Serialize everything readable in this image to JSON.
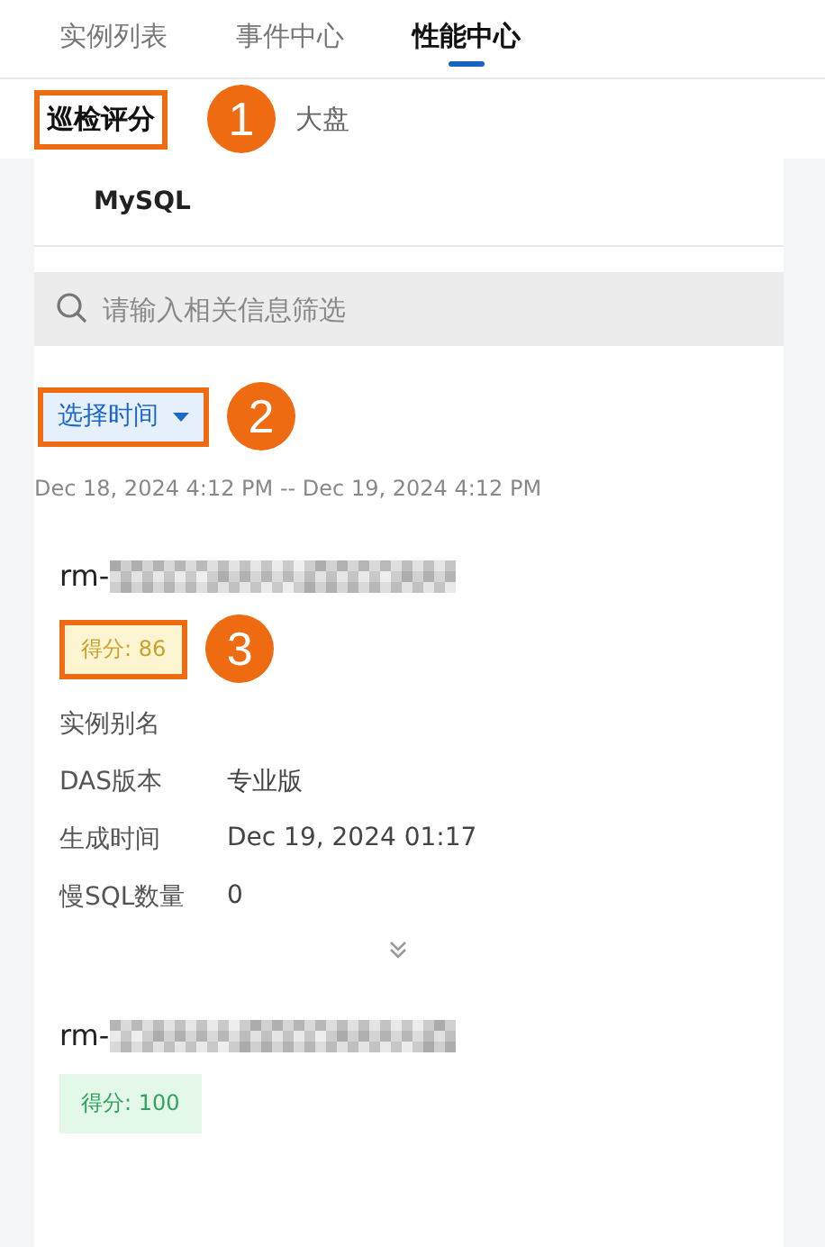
{
  "tabs": [
    {
      "label": "实例列表",
      "selected": false
    },
    {
      "label": "事件中心",
      "selected": false
    },
    {
      "label": "性能中心",
      "selected": true
    }
  ],
  "subtabs": [
    {
      "label": "巡检评分",
      "selected": true,
      "highlighted": true,
      "marker": "1"
    },
    {
      "label": "大盘",
      "selected": false,
      "highlighted": false
    }
  ],
  "engine": "MySQL",
  "search": {
    "placeholder": "请输入相关信息筛选"
  },
  "time_button": {
    "label": "选择时间",
    "highlighted": true,
    "marker": "2"
  },
  "time_range": "Dec 18, 2024 4:12 PM -- Dec 19, 2024 4:12 PM",
  "instances": [
    {
      "name": "rm-",
      "redacted": true,
      "score": "得分: 86",
      "kind": "warning",
      "highlighted": true,
      "marker": "3",
      "details": [
        {
          "label": "实例别名"
        },
        {
          "label": "DAS版本",
          "value": "专业版"
        },
        {
          "label": "生成时间",
          "value": "Dec 19, 2024 01:17"
        },
        {
          "label": "慢SQL数量",
          "value": "0"
        }
      ]
    },
    {
      "name": "rm-",
      "redacted": true,
      "score": "得分: 100",
      "kind": "good",
      "highlighted": false
    }
  ]
}
